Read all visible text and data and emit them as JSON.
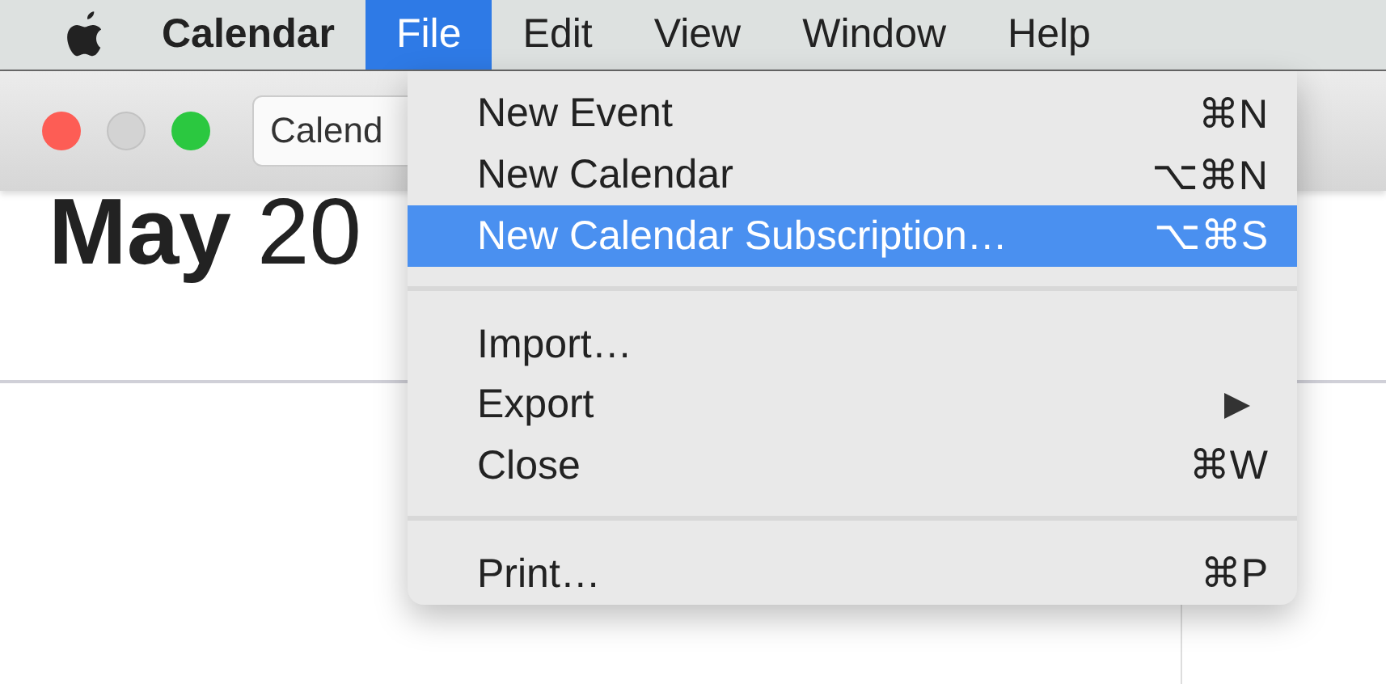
{
  "menu_bar": [
    {
      "kind": "apple",
      "selected": false
    },
    {
      "kind": "app",
      "label": "Calendar",
      "selected": false
    },
    {
      "kind": "menu",
      "label": "File",
      "selected": true
    },
    {
      "kind": "menu",
      "label": "Edit",
      "selected": false
    },
    {
      "kind": "menu",
      "label": "View",
      "selected": false
    },
    {
      "kind": "menu",
      "label": "Window",
      "selected": false
    },
    {
      "kind": "menu",
      "label": "Help",
      "selected": false
    }
  ],
  "window": {
    "toolbar_button": "Calend",
    "heading": "**May** 20"
  },
  "file_menu": {
    "sections": [
      [
        {
          "label": "New Event",
          "shortcut": "⌘N",
          "selected": false
        },
        {
          "label": "New Calendar",
          "shortcut": "⌥⌘N",
          "selected": false
        },
        {
          "label": "New Calendar Subscription…",
          "shortcut": "⌥⌘S",
          "selected": true
        }
      ],
      [
        {
          "label": "Import…",
          "selected": false
        },
        {
          "label": "Export",
          "selected": false,
          "submenu": true
        },
        {
          "label": "Close",
          "shortcut": "⌘W",
          "selected": false
        }
      ],
      [
        {
          "label": "Print…",
          "shortcut": "⌘P",
          "selected": false
        }
      ]
    ]
  }
}
